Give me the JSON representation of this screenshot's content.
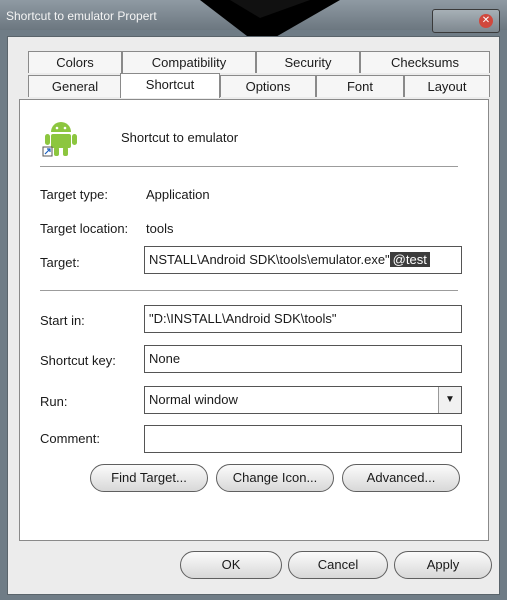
{
  "window": {
    "title": "Shortcut to emulator Propert"
  },
  "tabs_row1": [
    "Colors",
    "Compatibility",
    "Security",
    "Checksums"
  ],
  "tabs_row2": [
    "General",
    "Shortcut",
    "Options",
    "Font",
    "Layout"
  ],
  "active_tab": "Shortcut",
  "header": {
    "name": "Shortcut to emulator"
  },
  "fields": {
    "target_type": {
      "label": "Target type:",
      "value": "Application"
    },
    "target_location": {
      "label": "Target location:",
      "value": "tools"
    },
    "target": {
      "label": "Target:",
      "value": "NSTALL\\Android SDK\\tools\\emulator.exe\"",
      "selected": "@test"
    },
    "start_in": {
      "label": "Start in:",
      "value": "\"D:\\INSTALL\\Android SDK\\tools\""
    },
    "shortcut_key": {
      "label": "Shortcut key:",
      "value": "None"
    },
    "run": {
      "label": "Run:",
      "value": "Normal window"
    },
    "comment": {
      "label": "Comment:",
      "value": ""
    }
  },
  "panel_buttons": [
    "Find Target...",
    "Change Icon...",
    "Advanced..."
  ],
  "dialog_buttons": [
    "OK",
    "Cancel",
    "Apply"
  ],
  "icons": {
    "app": "android-icon",
    "close": "close-icon",
    "dropdown": "chevron-down-icon"
  },
  "colors": {
    "titlebar": "#7b8790",
    "selection": "#3c3c3c",
    "android_green": "#8cc63f"
  }
}
